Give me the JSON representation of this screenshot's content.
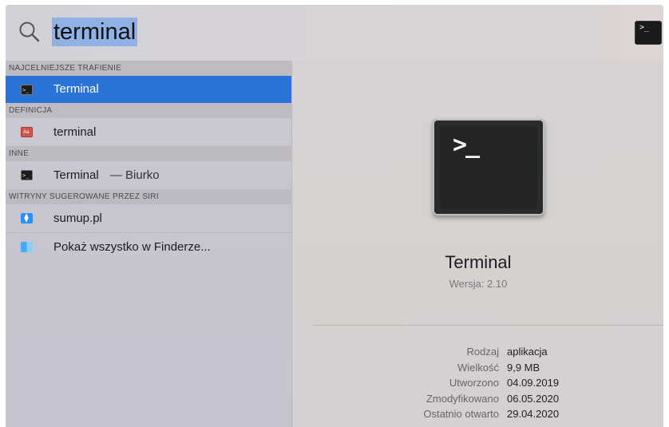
{
  "search": {
    "query": "terminal"
  },
  "top_icon": {
    "icon": "terminal-icon",
    "glyph": ">_"
  },
  "sections": [
    {
      "header": "NAJCELNIEJSZE TRAFIENIE"
    },
    {
      "header": "DEFINICJA"
    },
    {
      "header": "INNE"
    },
    {
      "header": "WITRYNY SUGEROWANE PRZEZ SIRI"
    }
  ],
  "results": {
    "top_hit": {
      "label": "Terminal",
      "icon": "terminal-icon"
    },
    "definition": {
      "label": "terminal",
      "icon": "dictionary-icon"
    },
    "other": {
      "label": "Terminal",
      "suffix": "— Biurko",
      "icon": "terminal-icon"
    },
    "siri_site": {
      "label": "sumup.pl",
      "icon": "safari-icon"
    },
    "finder": {
      "label": "Pokaż wszystko w Finderze...",
      "icon": "finder-icon"
    }
  },
  "preview": {
    "title": "Terminal",
    "version": "Wersja: 2.10",
    "icon_glyph": ">_",
    "metadata": [
      {
        "key": "Rodzaj",
        "value": "aplikacja"
      },
      {
        "key": "Wielkość",
        "value": "9,9 MB"
      },
      {
        "key": "Utworzono",
        "value": "04.09.2019"
      },
      {
        "key": "Zmodyfikowano",
        "value": "06.05.2020"
      },
      {
        "key": "Ostatnio otwarto",
        "value": "29.04.2020"
      }
    ]
  },
  "colors": {
    "selection": "#2a74d8",
    "query_highlight": "#8fb1e3"
  }
}
